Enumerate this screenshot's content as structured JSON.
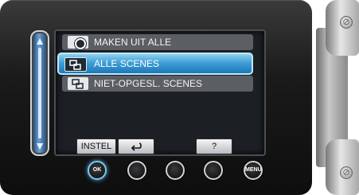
{
  "menu": {
    "items": [
      {
        "label": "MAKEN UIT ALLE",
        "icon": "disc-icon"
      },
      {
        "label": "ALLE SCENES",
        "icon": "scenes-icon"
      },
      {
        "label": "NIET-OPGESL. SCENES",
        "icon": "unsaved-scenes-icon"
      }
    ],
    "selected_index": 1
  },
  "softkeys": {
    "settings_label": "INSTEL",
    "back_icon": "back-arrow-icon",
    "help_label": "?"
  },
  "hardware_buttons": {
    "ok_label": "OK",
    "menu_label": "MENU"
  },
  "colors": {
    "selection": "#3f9fd6",
    "item_background": "#5b5e63",
    "body": "#1a1a1a"
  }
}
